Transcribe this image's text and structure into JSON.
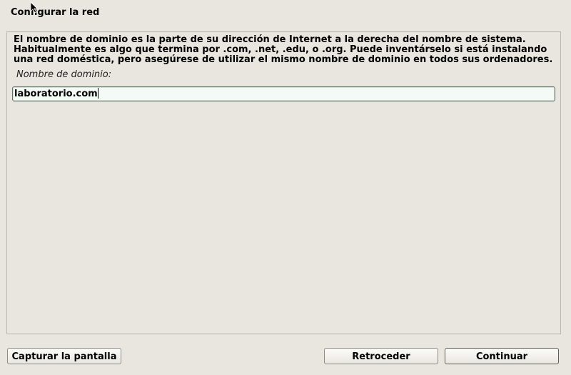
{
  "window": {
    "title": "Configurar la red"
  },
  "main": {
    "description": "El nombre de dominio es la parte de su dirección de Internet a la derecha del nombre de sistema.\nHabitualmente es algo que termina por .com, .net, .edu, o .org. Puede inventárselo si está instalando\nuna red doméstica, pero asegúrese de utilizar el mismo nombre de dominio en todos sus ordenadores.",
    "field_label": "Nombre de dominio:",
    "field_value": "laboratorio.com"
  },
  "buttons": {
    "screenshot": "Capturar la pantalla",
    "back": "Retroceder",
    "continue": "Continuar"
  }
}
